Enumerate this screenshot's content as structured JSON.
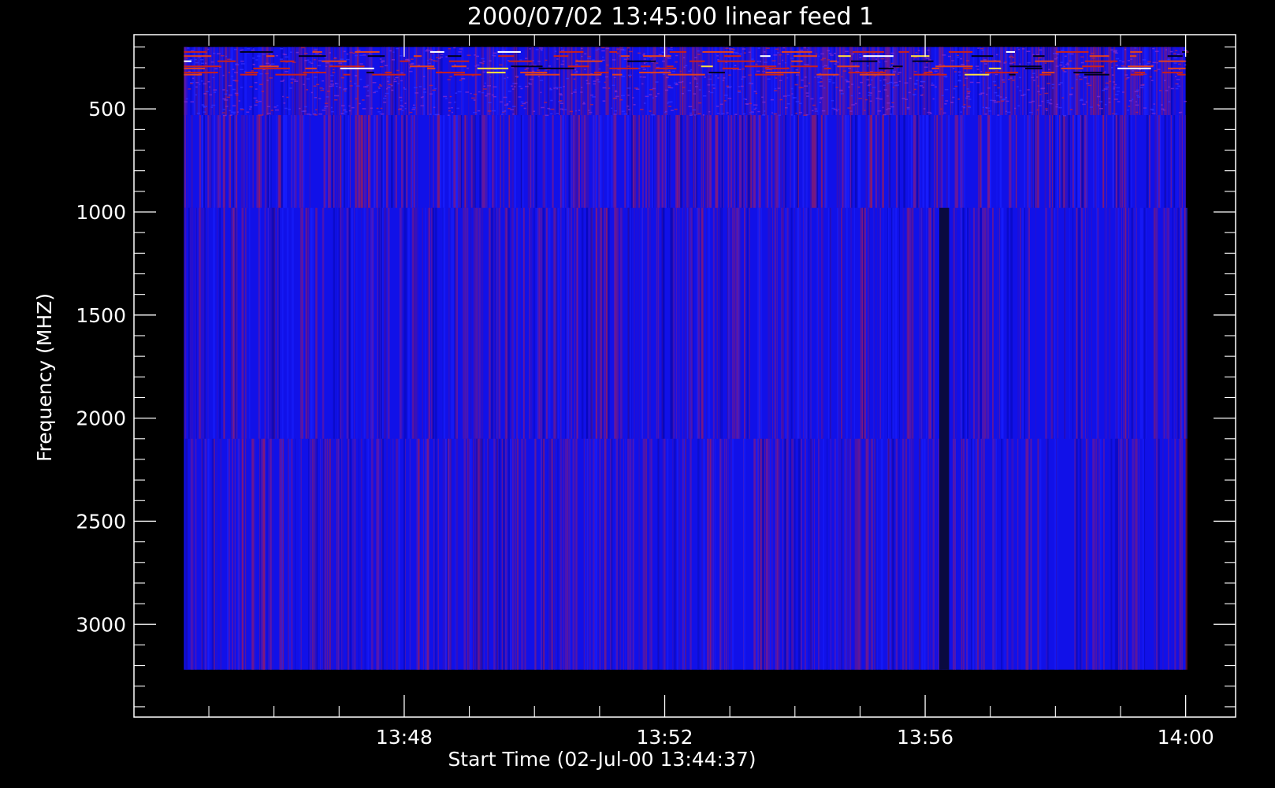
{
  "chart_data": {
    "type": "heatmap",
    "title": "2000/07/02 13:45:00 linear feed 1",
    "xlabel": "Start Time (02-Jul-00 13:44:37)",
    "ylabel": "Frequency (MHZ)",
    "x_tick_labels": [
      "13:48",
      "13:52",
      "13:56",
      "14:00"
    ],
    "x_tick_values_min": [
      3.383,
      7.383,
      11.383,
      15.383
    ],
    "y_tick_labels": [
      "500",
      "1000",
      "1500",
      "2000",
      "2500",
      "3000"
    ],
    "y_tick_values": [
      500,
      1000,
      1500,
      2000,
      2500,
      3000
    ],
    "xlim_min": [
      -0.767,
      16.15
    ],
    "ylim": [
      3450,
      140
    ],
    "data_xrange_min": [
      0.0,
      15.383
    ],
    "data_yrange": [
      200,
      3220
    ],
    "y_reversed": true,
    "bands": [
      {
        "freq_range": [
          200,
          530
        ],
        "description": "noisy interference band"
      },
      {
        "freq_range": [
          530,
          980
        ],
        "description": "speckled"
      },
      {
        "freq_range": [
          980,
          2100
        ],
        "description": "uniform"
      },
      {
        "freq_range": [
          2100,
          3220
        ],
        "description": "uniform"
      }
    ],
    "gap": {
      "time_min": 11.6,
      "width_min": 0.15,
      "freq_range": [
        980,
        3220
      ]
    },
    "grid": false,
    "colors": {
      "background": "#000000",
      "foreground": "#ffffff",
      "base": "#1111e8",
      "accent_red": "#c8201e",
      "accent_yellow": "#ffe040",
      "gap": "#0a0a40"
    }
  }
}
